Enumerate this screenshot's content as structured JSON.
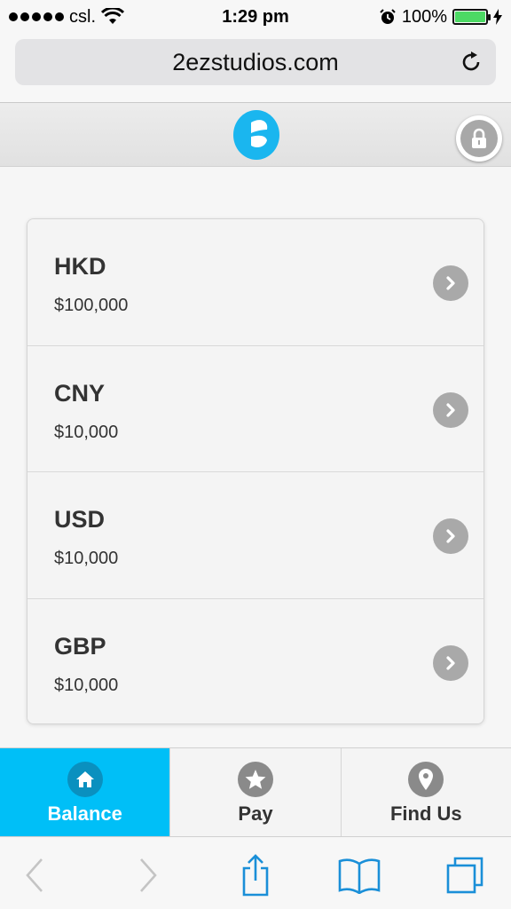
{
  "status_bar": {
    "carrier": "csl.",
    "time": "1:29 pm",
    "battery": "100%",
    "battery_level": 1.0
  },
  "browser": {
    "url": "2ezstudios.com"
  },
  "balances": [
    {
      "currency": "HKD",
      "amount": "$100,000"
    },
    {
      "currency": "CNY",
      "amount": "$10,000"
    },
    {
      "currency": "USD",
      "amount": "$10,000"
    },
    {
      "currency": "GBP",
      "amount": "$10,000"
    }
  ],
  "tabs": [
    {
      "label": "Balance",
      "icon": "home-icon",
      "active": true
    },
    {
      "label": "Pay",
      "icon": "star-icon",
      "active": false
    },
    {
      "label": "Find Us",
      "icon": "location-pin-icon",
      "active": false
    }
  ],
  "colors": {
    "accent": "#00bff7",
    "logo": "#1ab6ef",
    "safari_blue": "#1a8fd8",
    "battery_green": "#4cd964"
  }
}
